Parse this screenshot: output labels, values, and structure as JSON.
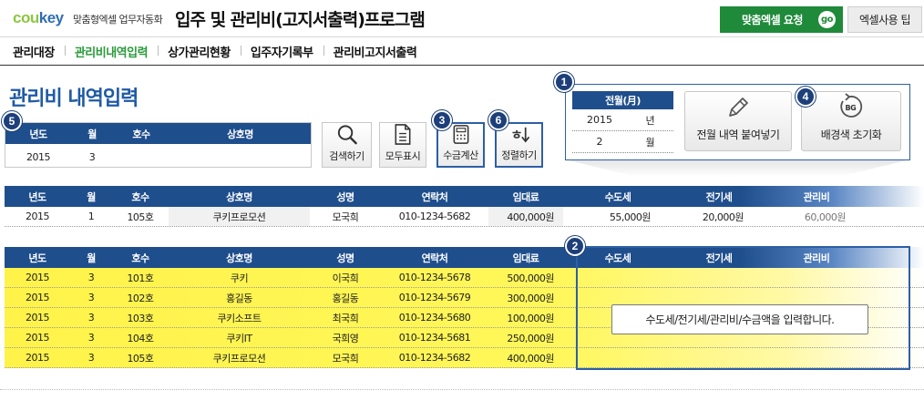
{
  "header": {
    "logo_c": "cou",
    "logo_rest": "key",
    "logo_sub": "맞춤형엑셀 업무자동화",
    "title": "입주 및 관리비(고지서출력)프로그램",
    "request_button": "맞춤엑셀 요청",
    "go_badge": "go",
    "tip_button": "엑셀사용 팁"
  },
  "nav": {
    "items": [
      "관리대장",
      "관리비내역입력",
      "상가관리현황",
      "입주자기록부",
      "관리비고지서출력"
    ],
    "active_index": 1
  },
  "page_title": "관리비 내역입력",
  "badges": [
    "1",
    "2",
    "3",
    "4",
    "5",
    "6"
  ],
  "search": {
    "headers": [
      "년도",
      "월",
      "호수",
      "상호명"
    ],
    "values": [
      "2015",
      "3",
      "",
      ""
    ]
  },
  "tools": {
    "search": "검색하기",
    "show_all": "모두표시",
    "calc": "수금계산",
    "sort": "정렬하기"
  },
  "prev_month": {
    "header": "전월(月)",
    "year_value": "2015",
    "year_unit": "년",
    "month_value": "2",
    "month_unit": "월",
    "paste_button": "전월 내역 붙여넣기",
    "reset_button": "배경색 초기화",
    "bg_glyph": "BG"
  },
  "columns": [
    "년도",
    "월",
    "호수",
    "상호명",
    "성명",
    "연락처",
    "임대료",
    "수도세",
    "전기세",
    "관리비"
  ],
  "prev_table": [
    [
      "2015",
      "1",
      "105호",
      "쿠키프로모션",
      "모국희",
      "010-1234-5682",
      "400,000원",
      "55,000원",
      "20,000원",
      "60,000원"
    ]
  ],
  "main_table": [
    [
      "2015",
      "3",
      "101호",
      "쿠키",
      "이국희",
      "010-1234-5678",
      "500,000원",
      "",
      "",
      ""
    ],
    [
      "2015",
      "3",
      "102호",
      "홍길동",
      "홍길동",
      "010-1234-5679",
      "300,000원",
      "",
      "",
      ""
    ],
    [
      "2015",
      "3",
      "103호",
      "쿠키소프트",
      "최국희",
      "010-1234-5680",
      "100,000원",
      "",
      "",
      ""
    ],
    [
      "2015",
      "3",
      "104호",
      "쿠키IT",
      "국희영",
      "010-1234-5681",
      "250,000원",
      "",
      "",
      ""
    ],
    [
      "2015",
      "3",
      "105호",
      "쿠키프로모션",
      "모국희",
      "010-1234-5682",
      "400,000원",
      "",
      "",
      ""
    ]
  ],
  "entry_tip": "수도세/전기세/관리비/수금액을 입력합니다.",
  "colors": {
    "navy": "#1f4e8c",
    "accent_blue": "#2d5fa6",
    "green": "#1f8a3a",
    "yellow": "#fff34a"
  }
}
